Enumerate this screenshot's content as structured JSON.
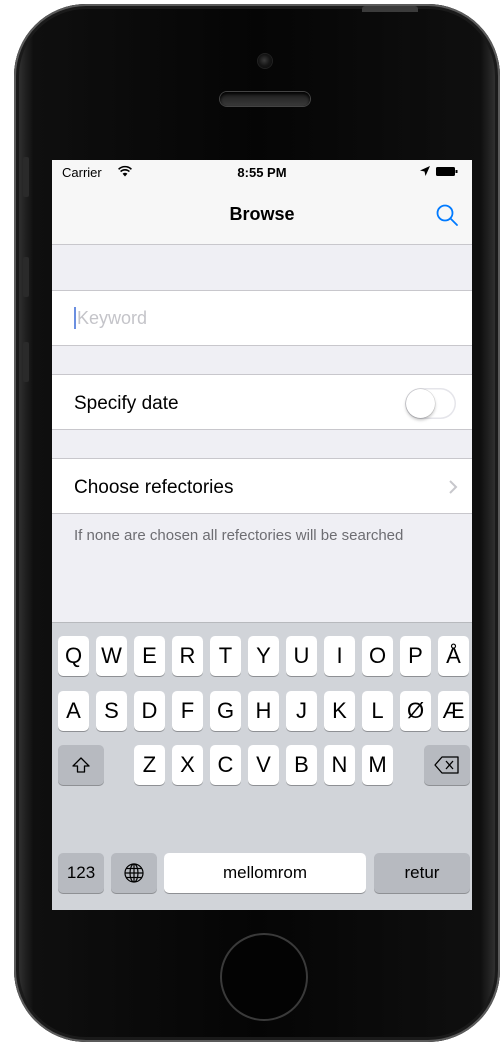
{
  "status_bar": {
    "carrier": "Carrier",
    "time": "8:55 PM"
  },
  "nav": {
    "title": "Browse",
    "search_icon": "search-icon"
  },
  "form": {
    "keyword": {
      "placeholder": "Keyword",
      "value": ""
    },
    "specify_date": {
      "label": "Specify date",
      "enabled": false
    },
    "choose_refectories": {
      "label": "Choose refectories"
    },
    "footnote": "If none are chosen all refectories will be searched"
  },
  "keyboard": {
    "row1": [
      "Q",
      "W",
      "E",
      "R",
      "T",
      "Y",
      "U",
      "I",
      "O",
      "P",
      "Å"
    ],
    "row2": [
      "A",
      "S",
      "D",
      "F",
      "G",
      "H",
      "J",
      "K",
      "L",
      "Ø",
      "Æ"
    ],
    "row3": [
      "Z",
      "X",
      "C",
      "V",
      "B",
      "N",
      "M"
    ],
    "numbers_label": "123",
    "space_label": "mellomrom",
    "return_label": "retur"
  },
  "colors": {
    "accent": "#007aff",
    "background": "#efeff4",
    "cell": "#ffffff"
  }
}
